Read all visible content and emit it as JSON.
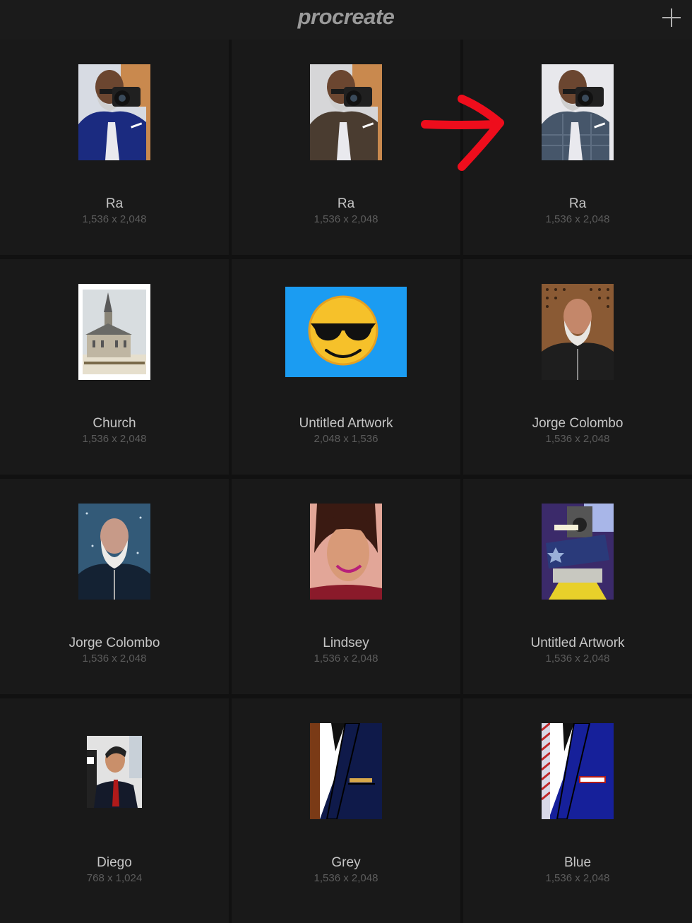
{
  "app": {
    "logo": "procreate"
  },
  "toolbar": {
    "add_label": "+"
  },
  "gallery": [
    {
      "title": "Ra",
      "dims": "1,536 x 2,048",
      "thumb": "ra-brown-portrait"
    },
    {
      "title": "Ra",
      "dims": "1,536 x 2,048",
      "thumb": "ra-grey-portrait"
    },
    {
      "title": "Ra",
      "dims": "1,536 x 2,048",
      "thumb": "ra-plaid-portrait"
    },
    {
      "title": "Church",
      "dims": "1,536 x 2,048",
      "thumb": "church-sketch"
    },
    {
      "title": "Untitled Artwork",
      "dims": "2,048 x 1,536",
      "thumb": "sunglasses-emoji"
    },
    {
      "title": "Jorge Colombo",
      "dims": "1,536 x 2,048",
      "thumb": "bearded-man-orange"
    },
    {
      "title": "Jorge Colombo",
      "dims": "1,536 x 2,048",
      "thumb": "bearded-man-snow"
    },
    {
      "title": "Lindsey",
      "dims": "1,536 x 2,048",
      "thumb": "smiling-woman"
    },
    {
      "title": "Untitled Artwork",
      "dims": "1,536 x 2,048",
      "thumb": "block-party-poster"
    },
    {
      "title": "Diego",
      "dims": "768 x 1,024",
      "thumb": "man-suit-profile"
    },
    {
      "title": "Grey",
      "dims": "1,536 x 2,048",
      "thumb": "suit-lapel-gold"
    },
    {
      "title": "Blue",
      "dims": "1,536 x 2,048",
      "thumb": "suit-lapel-stripes"
    }
  ],
  "colors": {
    "background": "#111111",
    "arrow": "#ee0d1c",
    "title": "#c6c6c6",
    "dims": "#5c5c5c"
  }
}
